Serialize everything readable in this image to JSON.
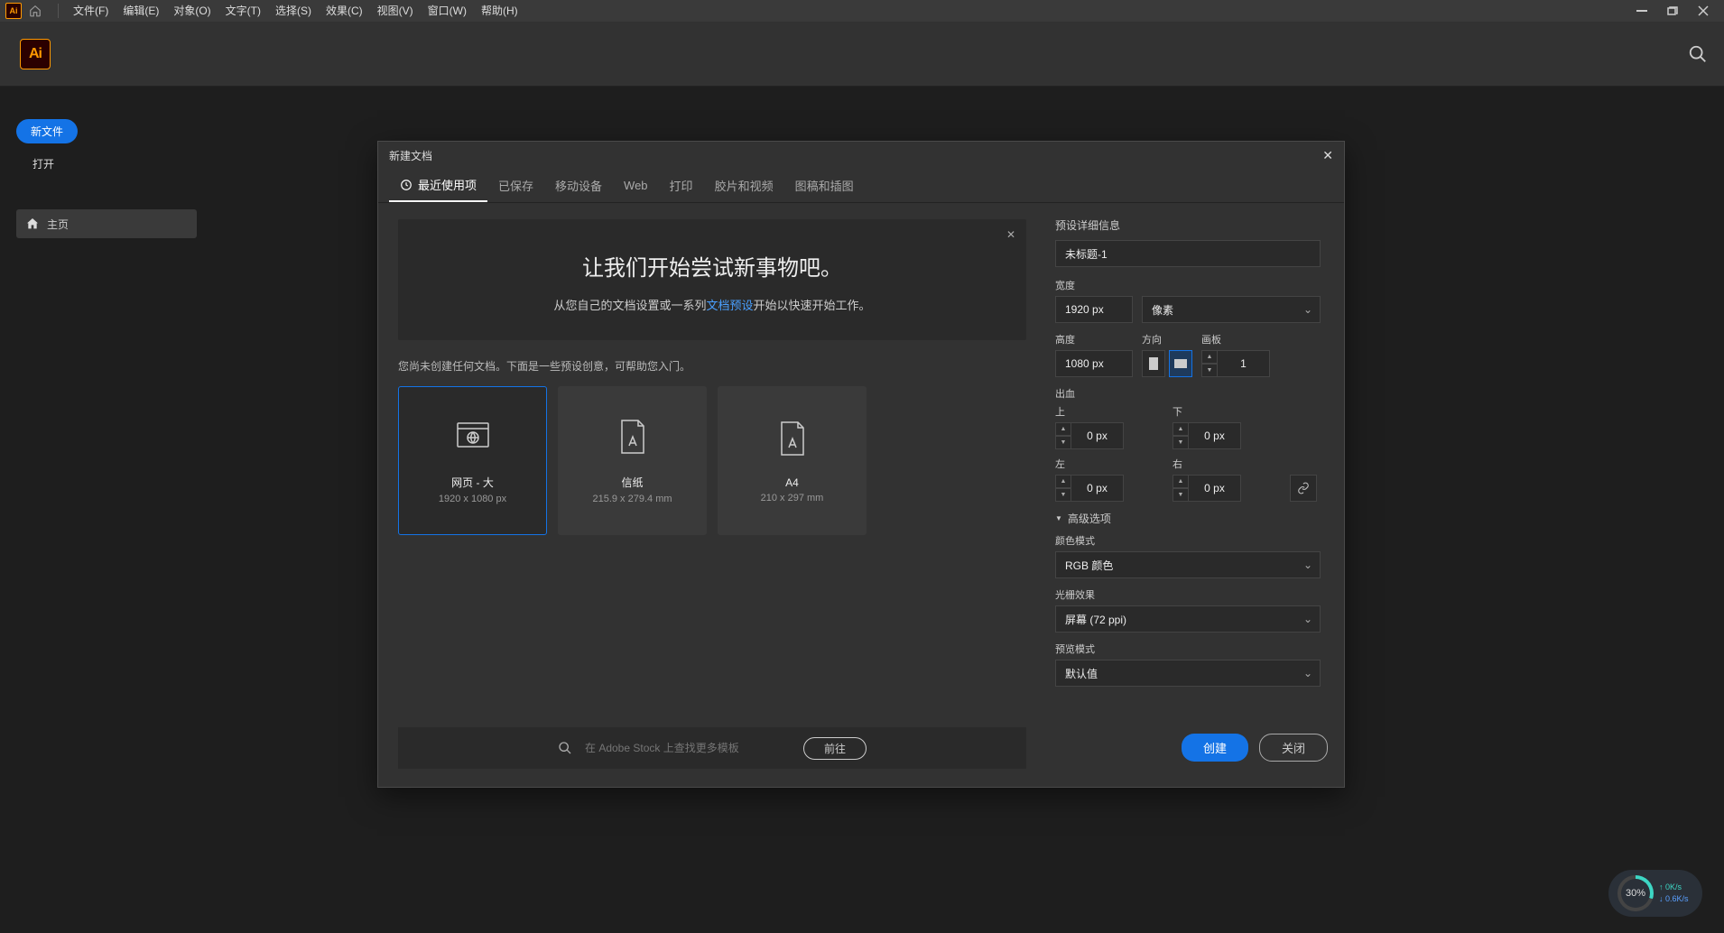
{
  "menubar": {
    "items": [
      "文件(F)",
      "编辑(E)",
      "对象(O)",
      "文字(T)",
      "选择(S)",
      "效果(C)",
      "视图(V)",
      "窗口(W)",
      "帮助(H)"
    ]
  },
  "sidebar": {
    "new_file": "新文件",
    "open": "打开",
    "home": "主页"
  },
  "modal": {
    "title": "新建文档",
    "tabs": [
      "最近使用项",
      "已保存",
      "移动设备",
      "Web",
      "打印",
      "胶片和视频",
      "图稿和插图"
    ],
    "hero_title": "让我们开始尝试新事物吧。",
    "hero_text_pre": "从您自己的文档设置或一系列",
    "hero_link": "文档预设",
    "hero_text_post": "开始以快速开始工作。",
    "hint": "您尚未创建任何文档。下面是一些预设创意，可帮助您入门。",
    "presets": [
      {
        "name": "网页 - 大",
        "size": "1920 x 1080 px",
        "selected": true,
        "icon": "web"
      },
      {
        "name": "信纸",
        "size": "215.9 x 279.4 mm",
        "selected": false,
        "icon": "print"
      },
      {
        "name": "A4",
        "size": "210 x 297 mm",
        "selected": false,
        "icon": "print"
      }
    ],
    "search_placeholder": "在 Adobe Stock 上查找更多模板",
    "go": "前往"
  },
  "details": {
    "title": "预设详细信息",
    "name": "未标题-1",
    "width_label": "宽度",
    "width": "1920 px",
    "unit": "像素",
    "height_label": "高度",
    "height": "1080 px",
    "orient_label": "方向",
    "artboard_label": "画板",
    "artboards": "1",
    "bleed_label": "出血",
    "top": "上",
    "bottom": "下",
    "left": "左",
    "right": "右",
    "bleed_val": "0 px",
    "advanced": "高级选项",
    "color_mode_label": "颜色模式",
    "color_mode": "RGB 颜色",
    "raster_label": "光栅效果",
    "raster": "屏幕 (72 ppi)",
    "preview_label": "预览模式",
    "preview": "默认值",
    "create": "创建",
    "close": "关闭"
  },
  "netspeed": {
    "percent": "30%",
    "up": "0K/s",
    "down": "0.6K/s"
  }
}
